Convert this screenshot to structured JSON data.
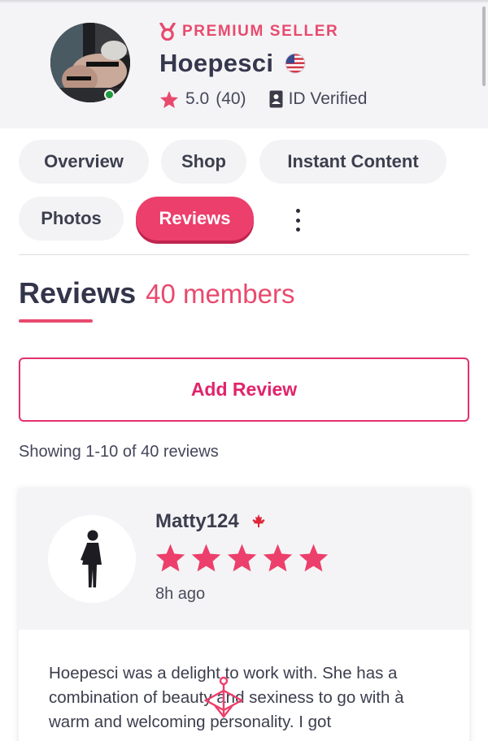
{
  "profile": {
    "badge_label": "PREMIUM SELLER",
    "badge_icon": "medal-icon",
    "username": "Hoepesci",
    "country_flag": "us-flag-icon",
    "rating": "5.0",
    "rating_count": "(40)",
    "verified_label": "ID Verified",
    "online": true
  },
  "tabs": [
    {
      "label": "Overview",
      "active": false
    },
    {
      "label": "Shop",
      "active": false
    },
    {
      "label": "Instant Content",
      "active": false
    },
    {
      "label": "Photos",
      "active": false
    },
    {
      "label": "Reviews",
      "active": true
    }
  ],
  "reviews_section": {
    "title": "Reviews",
    "count_label": "40 members",
    "add_review_label": "Add Review",
    "showing_label": "Showing 1-10 of 40 reviews"
  },
  "reviews": [
    {
      "name": "Matty124",
      "country_flag": "canada-flag-icon",
      "stars": 5,
      "time_ago": "8h ago",
      "text": "Hoepesci was a delight to work with. She has a combination of beauty and sexiness to go with à warm and welcoming personality. I got"
    }
  ],
  "colors": {
    "accent": "#e84a6e",
    "accent_button": "#ec3f6b",
    "header_bg": "#f4f4f6",
    "heading_text": "#33354b"
  }
}
